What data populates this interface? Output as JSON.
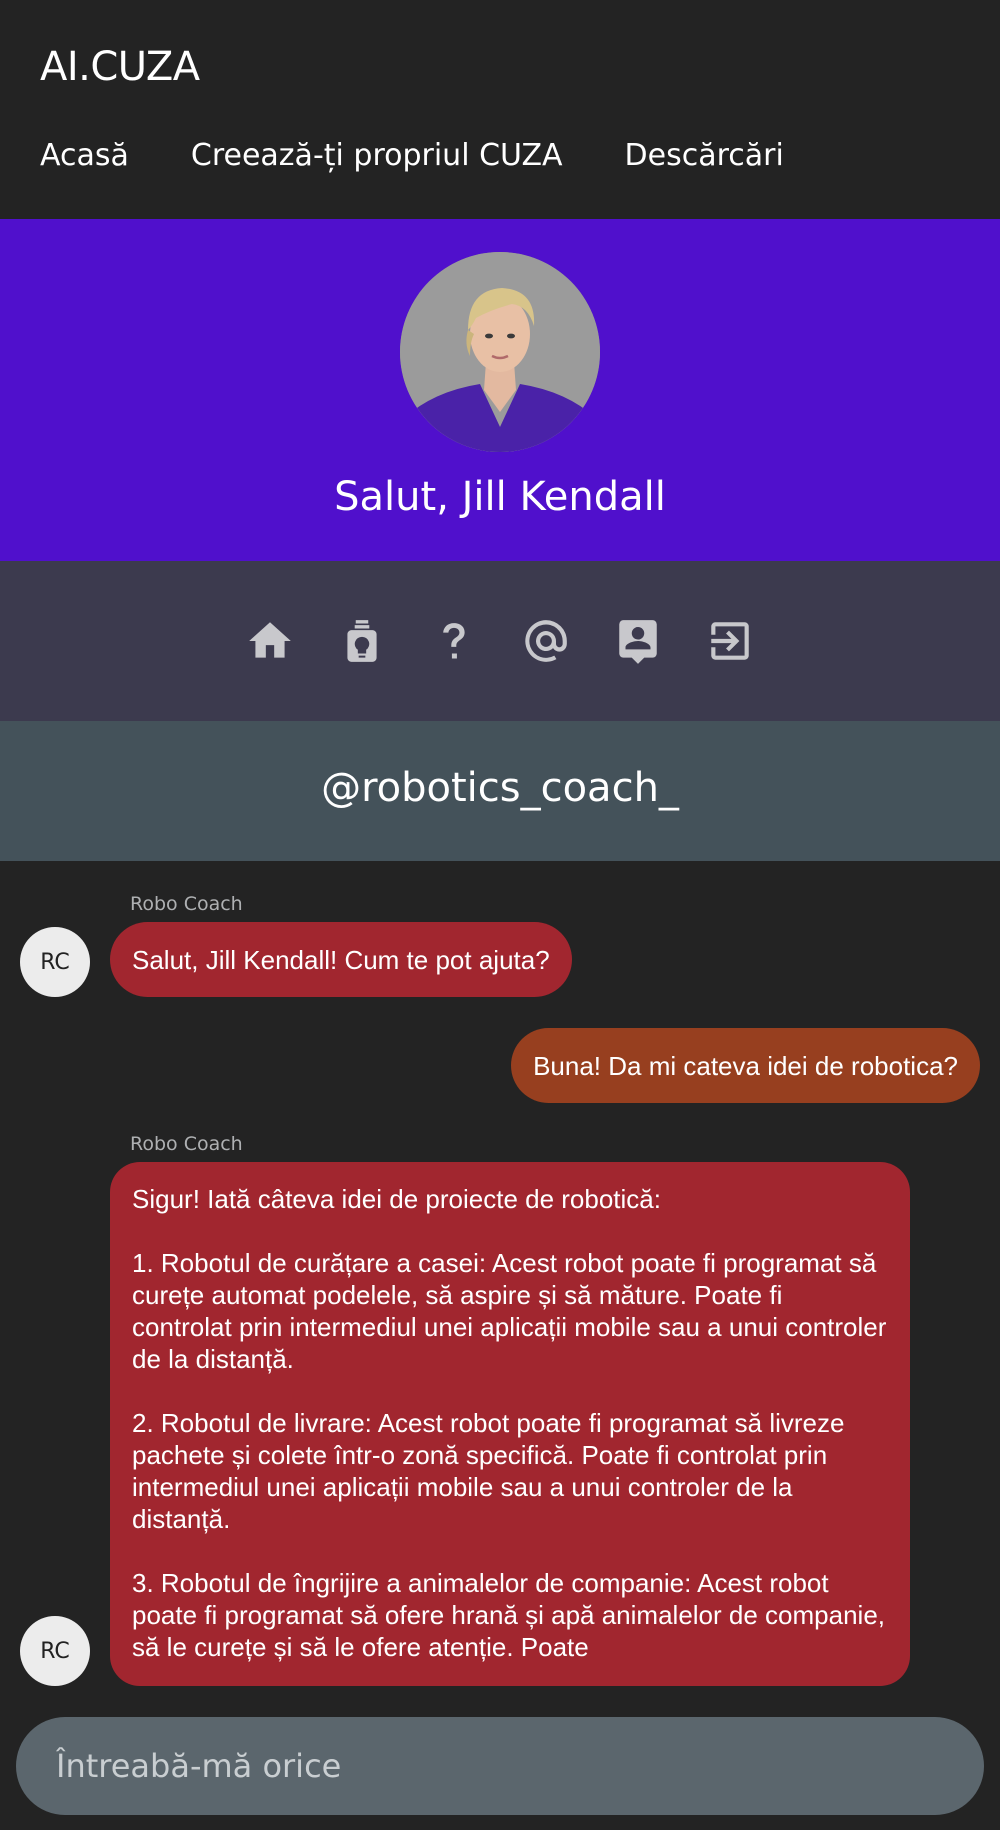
{
  "header": {
    "brand": "AI.CUZA",
    "nav": [
      "Acasă",
      "Creează-ți propriul CUZA",
      "Descărcări"
    ]
  },
  "profile": {
    "greeting": "Salut, Jill Kendall"
  },
  "icons": [
    "home-icon",
    "bulb-badge-icon",
    "question-icon",
    "at-sign-icon",
    "contact-icon",
    "logout-icon"
  ],
  "handle": "@robotics_coach_",
  "chat": {
    "messages": [
      {
        "sender": "Robo Coach",
        "avatar": "RC",
        "text": "Salut, Jill Kendall! Cum te pot ajuta?"
      },
      {
        "sender": "",
        "avatar": "",
        "text": "Buna! Da mi cateva idei de robotica?"
      },
      {
        "sender": "Robo Coach",
        "avatar": "RC",
        "text": "Sigur! Iată câteva idei de proiecte de robotică:\n\n1. Robotul de curățare a casei: Acest robot poate fi programat să curețe automat podelele, să aspire și să măture. Poate fi controlat prin intermediul unei aplicații mobile sau a unui controler de la distanță.\n\n2. Robotul de livrare: Acest robot poate fi programat să livreze pachete și colete într-o zonă specifică. Poate fi controlat prin intermediul unei aplicații mobile sau a unui controler de la distanță.\n\n3. Robotul de îngrijire a animalelor de companie: Acest robot poate fi programat să ofere hrană și apă animalelor de companie, să le curețe și să le ofere atenție. Poate"
      }
    ]
  },
  "input": {
    "placeholder": "Întreabă-mă orice",
    "value": ""
  },
  "colors": {
    "background": "#232323",
    "profile_band": "#5010cc",
    "icon_band": "#3c3a4e",
    "handle_band": "#44525a",
    "bot_bubble": "#a1262f",
    "user_bubble": "#973f1f",
    "input": "#5b666d"
  }
}
